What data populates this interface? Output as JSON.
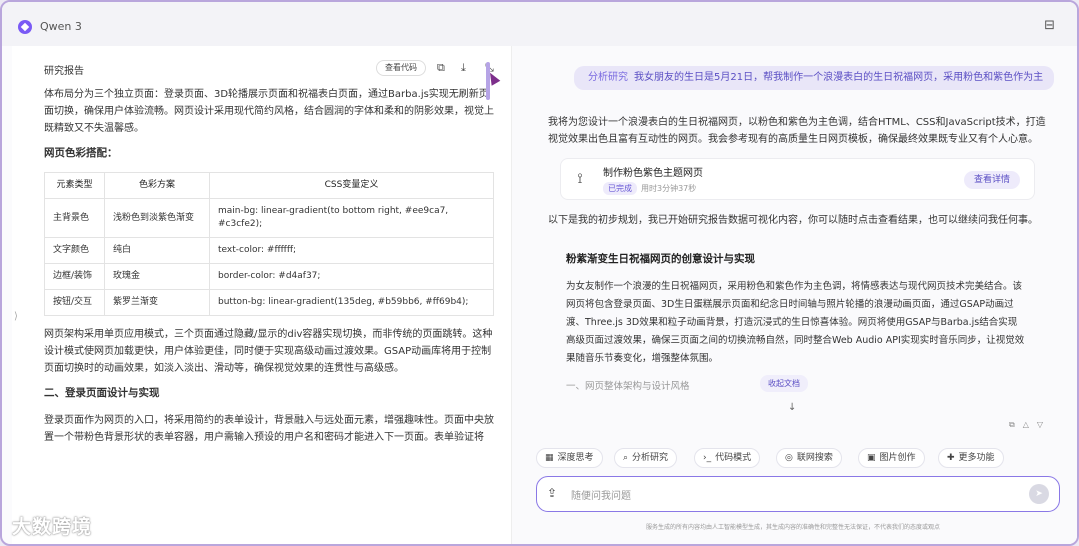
{
  "app": {
    "title": "Qwen 3",
    "corner_icon": "sidebar-toggle-icon"
  },
  "left": {
    "header": "研究报告",
    "view_toggle": "查看代码",
    "icons": [
      "copy-icon",
      "download-icon",
      "collapse-icon"
    ],
    "intro": "体布局分为三个独立页面：登录页面、3D轮播展示页面和祝福表白页面，通过Barba.js实现无刷新页面切换，确保用户体验流畅。网页设计采用现代简约风格，结合圆润的字体和柔和的阴影效果，视觉上既精致又不失温馨感。",
    "color_title": "网页色彩搭配：",
    "table_headers": [
      "元素类型",
      "色彩方案",
      "CSS变量定义"
    ],
    "table_rows": [
      [
        "主背景色",
        "浅粉色到淡紫色渐变",
        "main-bg: linear-gradient(to bottom right, #ee9ca7, #c3cfe2);"
      ],
      [
        "文字颜色",
        "纯白",
        "text-color: #ffffff;"
      ],
      [
        "边框/装饰",
        "玫瑰金",
        "border-color: #d4af37;"
      ],
      [
        "按钮/交互",
        "紫罗兰渐变",
        "button-bg: linear-gradient(135deg, #b59bb6, #ff69b4);"
      ]
    ],
    "para2": "网页架构采用单页应用模式，三个页面通过隐藏/显示的div容器实现切换，而非传统的页面跳转。这种设计模式使网页加载更快，用户体验更佳，同时便于实现高级动画过渡效果。GSAP动画库将用于控制页面切换时的动画效果，如淡入淡出、滑动等，确保视觉效果的连贯性与高级感。",
    "section2_title": "二、登录页面设计与实现",
    "para3": "登录页面作为网页的入口，将采用简约的表单设计，背景融入与远处面元素，增强趣味性。页面中央放置一个带粉色背景形状的表单容器，用户需输入预设的用户名和密码才能进入下一页面。表单验证将"
  },
  "watermark": "大数跨境",
  "right": {
    "user_tag": "分析研究",
    "user_message": "我女朋友的生日是5月21日，帮我制作一个浪漫表白的生日祝福网页，采用粉色和紫色作为主",
    "intro": "我将为您设计一个浪漫表白的生日祝福网页，以粉色和紫色为主色调，结合HTML、CSS和JavaScript技术，打造视觉效果出色且富有互动性的网页。我会参考现有的高质量生日网页模板，确保最终效果既专业又有个人心意。",
    "card": {
      "title": "制作粉色紫色主题网页",
      "status": "已完成",
      "meta": "用时3分钟37秒",
      "button": "查看详情"
    },
    "after": "以下是我的初步规划，我已开始研究报告数据可视化内容，你可以随时点击查看结果，也可以继续问我任何事。",
    "doc_title": "粉紫渐变生日祝福网页的创意设计与实现",
    "doc_body": "为女友制作一个浪漫的生日祝福网页，采用粉色和紫色作为主色调，将情感表达与现代网页技术完美结合。该网页将包含登录页面、3D生日蛋糕展示页面和纪念日时间轴与照片轮播的浪漫动画页面，通过GSAP动画过渡、Three.js 3D效果和粒子动画背景，打造沉浸式的生日惊喜体验。网页将使用GSAP与Barba.js结合实现高级页面过渡效果，确保三页面之间的切换流畅自然，同时整合Web Audio API实现实时音乐同步，让视觉效果随音乐节奏变化，增强整体氛围。",
    "doc_sub": "一、网页整体架构与设计风格",
    "collapse": "收起文档",
    "tools": [
      {
        "icon": "▦",
        "label": "深度思考"
      },
      {
        "icon": "⌕",
        "label": "分析研究"
      },
      {
        "icon": "›_",
        "label": "代码模式"
      },
      {
        "icon": "◎",
        "label": "联网搜索"
      },
      {
        "icon": "▣",
        "label": "图片创作"
      },
      {
        "icon": "✚",
        "label": "更多功能"
      }
    ],
    "input_placeholder": "随便问我问题",
    "disclaimer": "服务生成的所有内容均由人工智能模型生成，其生成内容的准确性和完整性无法保证，不代表我们的态度或观点"
  }
}
